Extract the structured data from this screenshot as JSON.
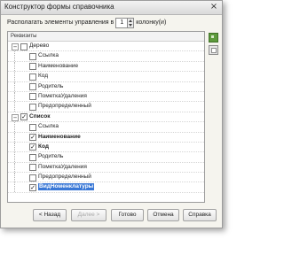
{
  "window": {
    "title": "Конструктор формы справочника",
    "close_glyph": "×"
  },
  "placement": {
    "prefix": "Располагать элементы управления в",
    "columns": "1",
    "suffix": "колонку(и)"
  },
  "tree": {
    "header": "Реквизиты",
    "groups": [
      {
        "label": "Дерево",
        "toggle": "−",
        "checked": false,
        "items": [
          {
            "label": "Ссылка",
            "checked": false
          },
          {
            "label": "Наименование",
            "checked": false
          },
          {
            "label": "Код",
            "checked": false
          },
          {
            "label": "Родитель",
            "checked": false
          },
          {
            "label": "ПометкаУдаления",
            "checked": false
          },
          {
            "label": "Предопределенный",
            "checked": false
          }
        ]
      },
      {
        "label": "Список",
        "toggle": "−",
        "checked": true,
        "items": [
          {
            "label": "Ссылка",
            "checked": false
          },
          {
            "label": "Наименование",
            "checked": true
          },
          {
            "label": "Код",
            "checked": true
          },
          {
            "label": "Родитель",
            "checked": false
          },
          {
            "label": "ПометкаУдаления",
            "checked": false
          },
          {
            "label": "Предопределенный",
            "checked": false
          },
          {
            "label": "ВидНоменклатуры",
            "checked": true,
            "selected": true
          }
        ]
      }
    ]
  },
  "buttons": {
    "back": "< Назад",
    "next": "Далее >",
    "done": "Готово",
    "cancel": "Отмена",
    "help": "Справка"
  },
  "icons": {
    "tree_tool_1": "settings-icon",
    "tree_tool_2": "copy-icon"
  },
  "colors": {
    "selection": "#3a78d6",
    "window_bg": "#f5f4ee"
  }
}
